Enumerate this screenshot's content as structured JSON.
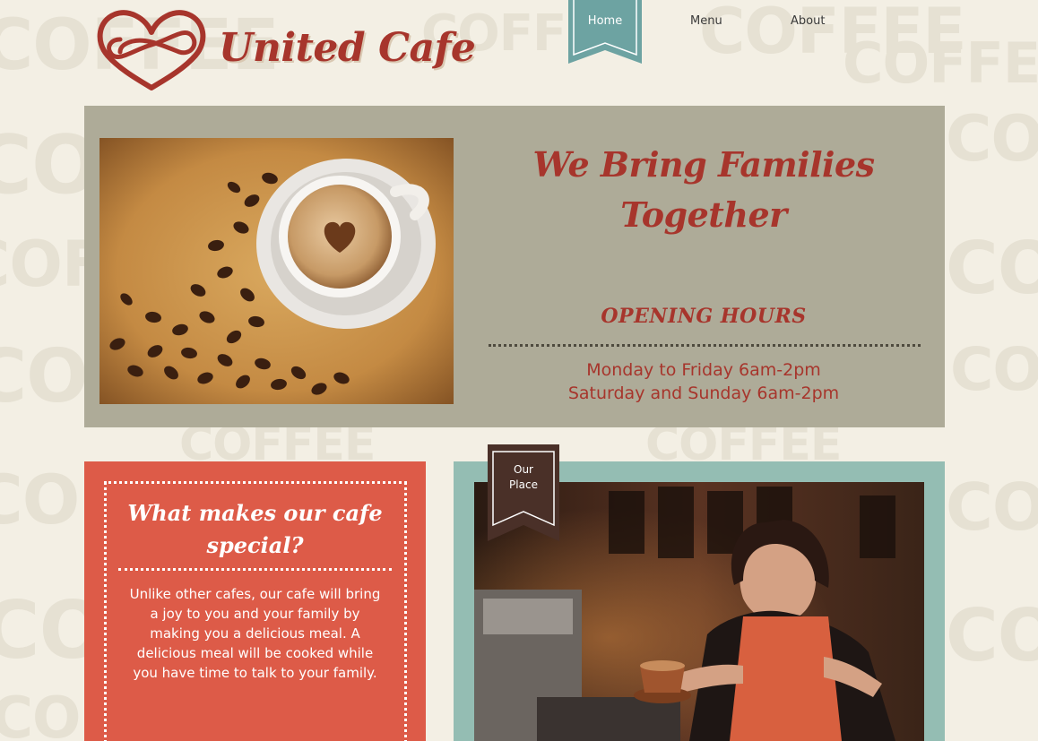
{
  "brand": {
    "name": "United Cafe",
    "color": "#a7352c"
  },
  "nav": {
    "items": [
      {
        "label": "Home",
        "active": true
      },
      {
        "label": "Menu",
        "active": false
      },
      {
        "label": "About",
        "active": false
      }
    ],
    "active_color": "#6da3a2"
  },
  "background_word": "COFFEE",
  "hero": {
    "title_line1": "We Bring Families",
    "title_line2": "Together",
    "hours_title": "OPENING HOURS",
    "hours": [
      "Monday to Friday 6am-2pm",
      "Saturday and Sunday 6am-2pm"
    ],
    "photo": "coffee-cup-with-heart-and-beans"
  },
  "special": {
    "title_line1": "What makes our cafe",
    "title_line2": "special?",
    "body": "Unlike other cafes, our cafe will bring a joy to you and your family by making you a delicious meal. A delicious meal will be cooked while you have time to talk to your family.",
    "color": "#dd5b48"
  },
  "place": {
    "ribbon_line1": "Our",
    "ribbon_line2": "Place",
    "photo": "barista-serving-coffee",
    "color": "#94bdb3"
  }
}
